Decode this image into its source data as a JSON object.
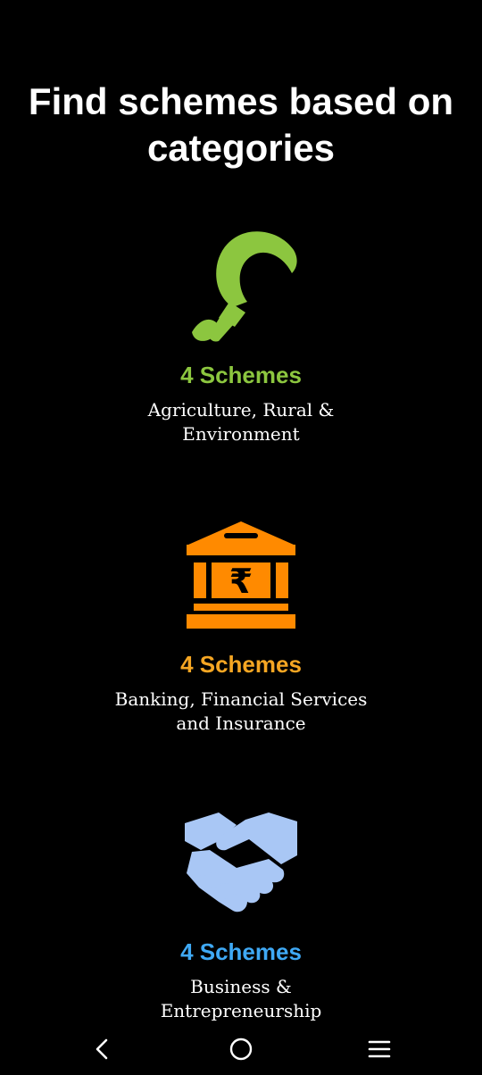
{
  "heading": "Find schemes based on categories",
  "categories": [
    {
      "icon": "sickle-icon",
      "count_label": "4 Schemes",
      "name": "Agriculture, Rural & Environment",
      "accent": "#8CC63F"
    },
    {
      "icon": "bank-rupee-icon",
      "count_label": "4 Schemes",
      "name": "Banking, Financial Services and Insurance",
      "accent": "#F5A623",
      "icon_color": "#FF8A00"
    },
    {
      "icon": "handshake-icon",
      "count_label": "4 Schemes",
      "name": "Business & Entrepreneurship",
      "accent": "#3FA9F5",
      "icon_color": "#A9C7F5"
    }
  ],
  "navigation": {
    "back": "back-icon",
    "home": "home-icon",
    "menu": "menu-icon"
  }
}
